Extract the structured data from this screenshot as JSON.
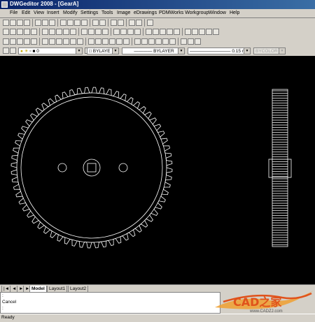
{
  "window": {
    "title": "DWGeditor 2008 - [GearA]"
  },
  "menu": [
    "File",
    "Edit",
    "View",
    "Insert",
    "Modify",
    "Settings",
    "Tools",
    "Image",
    "eDrawings",
    "PDMWorks Workgroup",
    "Window",
    "Help"
  ],
  "properties": {
    "layer": "0",
    "color": "BYLAYE",
    "linetype": "BYLAYER",
    "lineweight": "0.15 mm",
    "plotstyle": "BYCOLOR"
  },
  "tabs": {
    "nav": [
      "|◄",
      "◄",
      "►",
      "►|"
    ],
    "model": "Model",
    "layout1": "Layout1",
    "layout2": "Layout2"
  },
  "command": {
    "line1": ":",
    "line2": "Cancel",
    "line3": ":"
  },
  "status": {
    "text": "Ready"
  },
  "watermark": {
    "logo_text": "CAD之家",
    "url": "www.CADZJ.com"
  },
  "colors": {
    "titlebar": "#0a246a",
    "canvas": "#000000",
    "chrome": "#d4d0c8",
    "watermark": "#e0521b"
  }
}
